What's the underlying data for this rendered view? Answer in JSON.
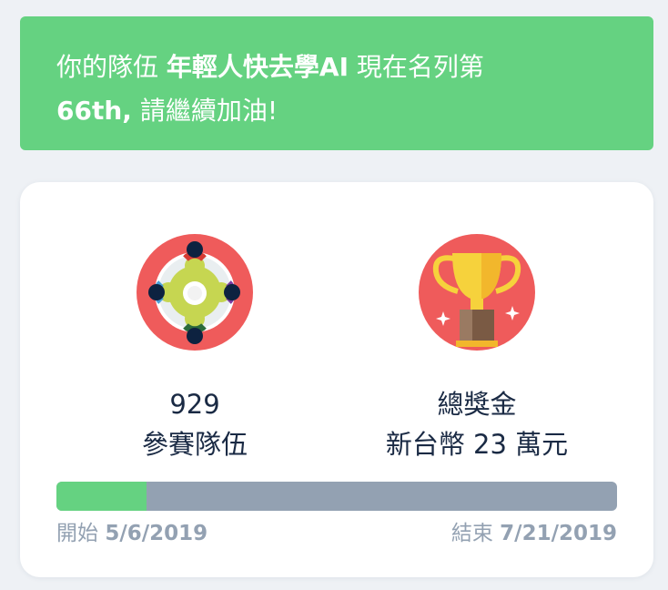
{
  "banner": {
    "prefix": "你的隊伍",
    "team_name": "年輕人快去學AI",
    "middle": "現在名列第",
    "rank": "66th,",
    "suffix": "請繼續加油!"
  },
  "stats": {
    "teams": {
      "value": "929",
      "label": "參賽隊伍",
      "icon": "teams-icon"
    },
    "prize": {
      "value": "總獎金",
      "label": "新台幣 23 萬元",
      "icon": "trophy-icon"
    }
  },
  "timeline": {
    "start_label": "開始",
    "start_date": "5/6/2019",
    "end_label": "結束",
    "end_date": "7/21/2019",
    "progress_fraction": 0.16
  },
  "colors": {
    "accent_green": "#65d281",
    "track_gray": "#93a1b2",
    "icon_red": "#ef5b5b",
    "text_dark": "#1a2a44"
  }
}
